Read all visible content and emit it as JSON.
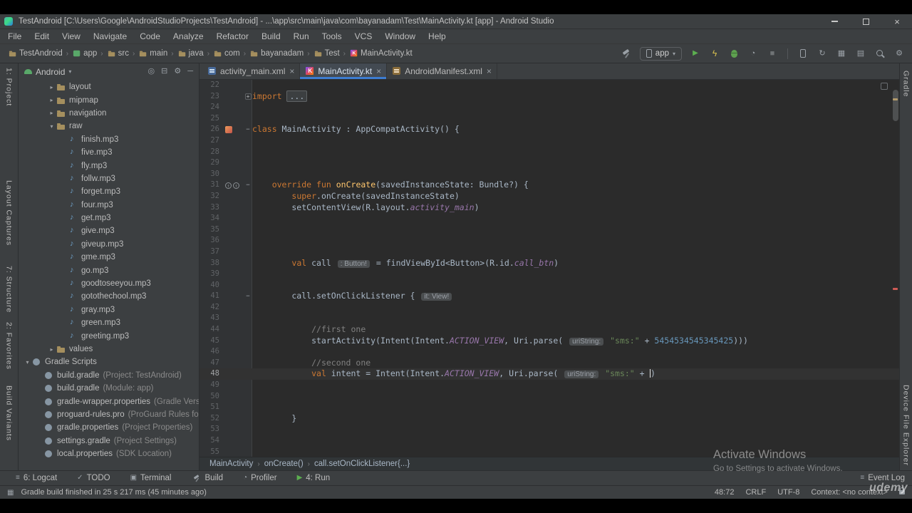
{
  "window": {
    "title": "TestAndroid [C:\\Users\\Google\\AndroidStudioProjects\\TestAndroid] - ...\\app\\src\\main\\java\\com\\bayanadam\\Test\\MainActivity.kt [app] - Android Studio"
  },
  "menubar": [
    "File",
    "Edit",
    "View",
    "Navigate",
    "Code",
    "Analyze",
    "Refactor",
    "Build",
    "Run",
    "Tools",
    "VCS",
    "Window",
    "Help"
  ],
  "navigation_bar": [
    {
      "label": "TestAndroid",
      "icon": "folder"
    },
    {
      "label": "app",
      "icon": "module"
    },
    {
      "label": "src",
      "icon": "folder"
    },
    {
      "label": "main",
      "icon": "folder"
    },
    {
      "label": "java",
      "icon": "folder"
    },
    {
      "label": "com",
      "icon": "folder"
    },
    {
      "label": "bayanadam",
      "icon": "folder"
    },
    {
      "label": "Test",
      "icon": "folder"
    },
    {
      "label": "MainActivity.kt",
      "icon": "kotlin"
    }
  ],
  "toolbar_actions": [
    {
      "name": "build-button",
      "shape": "hammer"
    },
    {
      "name": "run-configuration-select",
      "type": "select",
      "label": "app"
    },
    {
      "name": "run-button",
      "icon": "run"
    },
    {
      "name": "apply-changes-button",
      "icon": "bolt"
    },
    {
      "name": "debug-button",
      "shape": "debug"
    },
    {
      "name": "profile-button",
      "icon": "profile"
    },
    {
      "name": "stop-button",
      "icon": "stop"
    },
    {
      "type": "separator"
    },
    {
      "name": "device-manager-button",
      "shape": "phone"
    },
    {
      "name": "gradle-sync-button",
      "icon": "sync"
    },
    {
      "name": "sdk-manager-button",
      "icon": "sdk"
    },
    {
      "name": "layout-inspector-button",
      "icon": "layers"
    },
    {
      "name": "search-everywhere-button",
      "shape": "search"
    },
    {
      "name": "settings-button",
      "icon": "gear"
    }
  ],
  "left_strip": [
    "1: Project",
    "Layout Captures",
    "7: Structure",
    "2: Favorites",
    "Build Variants"
  ],
  "right_strip": [
    "Gradle",
    "Device File Explorer"
  ],
  "project_panel": {
    "selector": "Android",
    "header_icons": [
      "locate",
      "collapse-all",
      "settings",
      "hide"
    ],
    "tree": [
      {
        "indent": 2,
        "arrow": "closed",
        "icon": "folder",
        "label": "layout"
      },
      {
        "indent": 2,
        "arrow": "closed",
        "icon": "folder",
        "label": "mipmap"
      },
      {
        "indent": 2,
        "arrow": "closed",
        "icon": "folder",
        "label": "navigation"
      },
      {
        "indent": 2,
        "arrow": "open",
        "icon": "folder",
        "label": "raw"
      },
      {
        "indent": 3,
        "icon": "audio",
        "label": "finish.mp3"
      },
      {
        "indent": 3,
        "icon": "audio",
        "label": "five.mp3"
      },
      {
        "indent": 3,
        "icon": "audio",
        "label": "fly.mp3"
      },
      {
        "indent": 3,
        "icon": "audio",
        "label": "follw.mp3"
      },
      {
        "indent": 3,
        "icon": "audio",
        "label": "forget.mp3"
      },
      {
        "indent": 3,
        "icon": "audio",
        "label": "four.mp3"
      },
      {
        "indent": 3,
        "icon": "audio",
        "label": "get.mp3"
      },
      {
        "indent": 3,
        "icon": "audio",
        "label": "give.mp3"
      },
      {
        "indent": 3,
        "icon": "audio",
        "label": "giveup.mp3"
      },
      {
        "indent": 3,
        "icon": "audio",
        "label": "gme.mp3"
      },
      {
        "indent": 3,
        "icon": "audio",
        "label": "go.mp3"
      },
      {
        "indent": 3,
        "icon": "audio",
        "label": "goodtoseeyou.mp3"
      },
      {
        "indent": 3,
        "icon": "audio",
        "label": "gotothechool.mp3"
      },
      {
        "indent": 3,
        "icon": "audio",
        "label": "gray.mp3"
      },
      {
        "indent": 3,
        "icon": "audio",
        "label": "green.mp3"
      },
      {
        "indent": 3,
        "icon": "audio",
        "label": "greeting.mp3"
      },
      {
        "indent": 2,
        "arrow": "closed",
        "icon": "folder",
        "label": "values"
      },
      {
        "indent": 0,
        "arrow": "open",
        "icon": "gradle",
        "label": "Gradle Scripts"
      },
      {
        "indent": 1,
        "icon": "gradle",
        "label": "build.gradle",
        "detail": "(Project: TestAndroid)"
      },
      {
        "indent": 1,
        "icon": "gradle",
        "label": "build.gradle",
        "detail": "(Module: app)"
      },
      {
        "indent": 1,
        "icon": "gradle",
        "label": "gradle-wrapper.properties",
        "detail": "(Gradle Versi"
      },
      {
        "indent": 1,
        "icon": "gradle",
        "label": "proguard-rules.pro",
        "detail": "(ProGuard Rules for"
      },
      {
        "indent": 1,
        "icon": "gradle",
        "label": "gradle.properties",
        "detail": "(Project Properties)"
      },
      {
        "indent": 1,
        "icon": "gradle",
        "label": "settings.gradle",
        "detail": "(Project Settings)"
      },
      {
        "indent": 1,
        "icon": "gradle",
        "label": "local.properties",
        "detail": "(SDK Location)"
      }
    ]
  },
  "editor": {
    "tabs": [
      {
        "label": "activity_main.xml",
        "icon": "layout",
        "active": false
      },
      {
        "label": "MainActivity.kt",
        "icon": "kotlin",
        "active": true
      },
      {
        "label": "AndroidManifest.xml",
        "icon": "manifest",
        "active": false
      }
    ],
    "breadcrumbs": [
      "MainActivity",
      "onCreate()",
      "call.setOnClickListener{...}"
    ],
    "lines": [
      {
        "n": 22,
        "p": []
      },
      {
        "n": 23,
        "g": "+",
        "p": [
          [
            "import",
            "k"
          ],
          [
            " ",
            "t"
          ],
          [
            "...",
            "fo"
          ]
        ]
      },
      {
        "n": 24,
        "p": []
      },
      {
        "n": 25,
        "p": []
      },
      {
        "n": 26,
        "g": "-",
        "ic": "class",
        "p": [
          [
            "class",
            "k"
          ],
          [
            " MainActivity : AppCompatActivity() {",
            "t"
          ]
        ]
      },
      {
        "n": 27,
        "p": []
      },
      {
        "n": 28,
        "p": []
      },
      {
        "n": 29,
        "p": []
      },
      {
        "n": 30,
        "p": []
      },
      {
        "n": 31,
        "g": "-",
        "ic": "override",
        "p": [
          [
            "    ",
            "t"
          ],
          [
            "override",
            "k"
          ],
          [
            " ",
            "t"
          ],
          [
            "fun",
            "k"
          ],
          [
            " ",
            "t"
          ],
          [
            "onCreate",
            "f"
          ],
          [
            "(savedInstanceState: Bundle?) {",
            "t"
          ]
        ]
      },
      {
        "n": 32,
        "p": [
          [
            "        ",
            "t"
          ],
          [
            "super",
            "k"
          ],
          [
            ".onCreate(savedInstanceState)",
            "t"
          ]
        ]
      },
      {
        "n": 33,
        "p": [
          [
            "        setContentView(R.layout.",
            "t"
          ],
          [
            "activity_main",
            "d"
          ],
          [
            ")",
            "t"
          ]
        ]
      },
      {
        "n": 34,
        "p": []
      },
      {
        "n": 35,
        "p": []
      },
      {
        "n": 36,
        "p": []
      },
      {
        "n": 37,
        "p": []
      },
      {
        "n": 38,
        "p": [
          [
            "        ",
            "t"
          ],
          [
            "val",
            "k"
          ],
          [
            " call ",
            "t"
          ],
          [
            ": Button!",
            "h"
          ],
          [
            " = findViewById<Button>(R.id.",
            "t"
          ],
          [
            "call_btn",
            "d"
          ],
          [
            ")",
            "t"
          ]
        ]
      },
      {
        "n": 39,
        "p": []
      },
      {
        "n": 40,
        "p": []
      },
      {
        "n": 41,
        "g": "-",
        "p": [
          [
            "        call.setOnClickListener { ",
            "t"
          ],
          [
            "it: View!",
            "h"
          ]
        ]
      },
      {
        "n": 42,
        "p": []
      },
      {
        "n": 43,
        "p": []
      },
      {
        "n": 44,
        "p": [
          [
            "            ",
            "t"
          ],
          [
            "//first one",
            "c"
          ]
        ]
      },
      {
        "n": 45,
        "p": [
          [
            "            startActivity(Intent(Intent.",
            "t"
          ],
          [
            "ACTION_VIEW",
            "d"
          ],
          [
            ", Uri.parse( ",
            "t"
          ],
          [
            "uriString:",
            "h"
          ],
          [
            " ",
            "t"
          ],
          [
            "\"sms:\"",
            "s"
          ],
          [
            " + ",
            "t"
          ],
          [
            "5454534545345425",
            "nu"
          ],
          [
            ")))",
            "t"
          ]
        ]
      },
      {
        "n": 46,
        "p": []
      },
      {
        "n": 47,
        "p": [
          [
            "            ",
            "t"
          ],
          [
            "//second one",
            "c"
          ]
        ]
      },
      {
        "n": 48,
        "cur": true,
        "p": [
          [
            "            ",
            "t"
          ],
          [
            "val",
            "k"
          ],
          [
            " intent = Intent(Intent.",
            "t"
          ],
          [
            "ACTION_VIEW",
            "d"
          ],
          [
            ", Uri.parse( ",
            "t"
          ],
          [
            "uriString:",
            "h"
          ],
          [
            " ",
            "t"
          ],
          [
            "\"sms:\"",
            "s"
          ],
          [
            " + ",
            "t"
          ],
          [
            "",
            "cr"
          ],
          [
            ")",
            "t"
          ]
        ]
      },
      {
        "n": 49,
        "p": []
      },
      {
        "n": 50,
        "p": []
      },
      {
        "n": 51,
        "p": []
      },
      {
        "n": 52,
        "p": [
          [
            "        }",
            "t"
          ]
        ]
      },
      {
        "n": 53,
        "p": []
      },
      {
        "n": 54,
        "p": []
      },
      {
        "n": 55,
        "p": []
      }
    ]
  },
  "bottom_bar": {
    "left": [
      {
        "label": "6: Logcat",
        "icon": "logcat"
      },
      {
        "label": "TODO",
        "icon": "todo"
      },
      {
        "label": "Terminal",
        "icon": "terminal"
      },
      {
        "label": "Build",
        "icon": "build"
      },
      {
        "label": "Profiler",
        "icon": "profile"
      },
      {
        "label": "4: Run",
        "icon": "run"
      }
    ],
    "right": [
      {
        "label": "Event Log",
        "icon": "event-log"
      }
    ]
  },
  "status_bar": {
    "message": "Gradle build finished in 25 s 217 ms (45 minutes ago)",
    "caret_position": "48:72",
    "line_separator": "CRLF",
    "encoding": "UTF-8",
    "context": "Context: <no context>"
  },
  "watermark": {
    "line1": "Activate Windows",
    "line2": "Go to Settings to activate Windows."
  },
  "video_watermark": "udemy",
  "colors": {
    "accent": "#3d7dd1",
    "keyword": "#cc7832",
    "string": "#6a8759",
    "number": "#6897bb",
    "comment": "#808080",
    "editor_bg": "#2b2b2b",
    "panel_bg": "#3c3f41"
  }
}
